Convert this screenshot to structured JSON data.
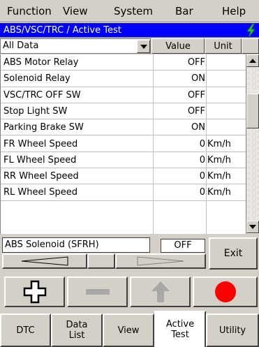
{
  "menu": [
    "Function",
    "View",
    "System",
    "Bar",
    "Help"
  ],
  "window_title": "ABS/VSC/TRC / Active Test",
  "filter": {
    "selected": "All Data"
  },
  "columns": {
    "value": "Value",
    "unit": "Unit"
  },
  "rows": [
    {
      "name": "ABS Motor Relay",
      "value": "OFF",
      "unit": ""
    },
    {
      "name": "Solenoid Relay",
      "value": "ON",
      "unit": ""
    },
    {
      "name": "VSC/TRC OFF SW",
      "value": "OFF",
      "unit": ""
    },
    {
      "name": "Stop Light SW",
      "value": "OFF",
      "unit": ""
    },
    {
      "name": "Parking Brake SW",
      "value": "ON",
      "unit": ""
    },
    {
      "name": "FR Wheel Speed",
      "value": "0",
      "unit": "Km/h"
    },
    {
      "name": "FL Wheel Speed",
      "value": "0",
      "unit": "Km/h"
    },
    {
      "name": "RR Wheel Speed",
      "value": "0",
      "unit": "Km/h"
    },
    {
      "name": "RL Wheel Speed",
      "value": "0",
      "unit": "Km/h"
    }
  ],
  "active_test": {
    "item": "ABS Solenoid (SFRH)",
    "value": "OFF",
    "exit_label": "Exit"
  },
  "action_icons": [
    "plus-icon",
    "minus-icon",
    "up-arrow-icon",
    "record-icon"
  ],
  "colors": {
    "title_bg": "#0000ff",
    "record": "#ff0000",
    "bolt": "#22cc22"
  },
  "tabs": [
    {
      "label": "DTC"
    },
    {
      "label": "Data List"
    },
    {
      "label": "View"
    },
    {
      "label": "Active Test",
      "active": true
    },
    {
      "label": "Utility"
    }
  ]
}
